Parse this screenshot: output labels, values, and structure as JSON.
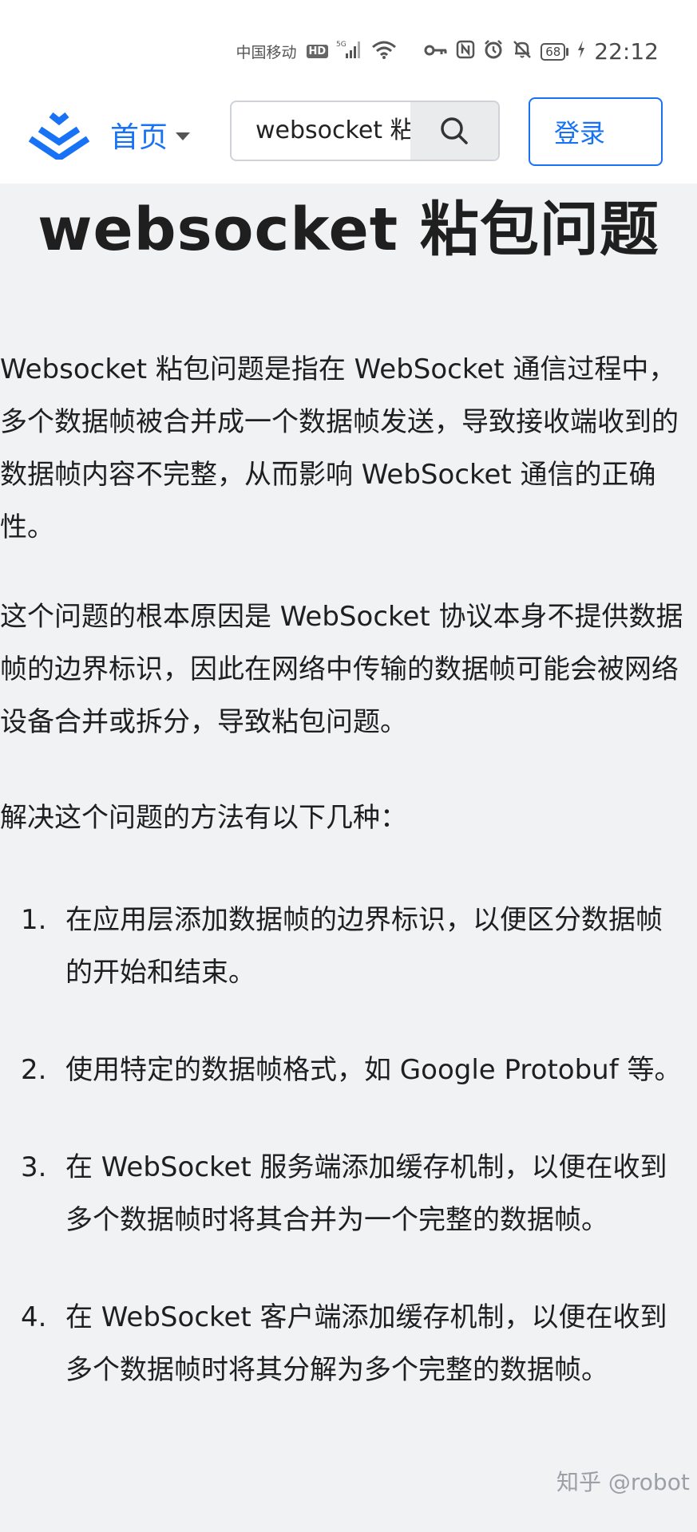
{
  "status_bar": {
    "carrier": "中国移动",
    "hd": "HD",
    "network": "5G",
    "battery": "68",
    "time": "22:12",
    "icons": [
      "signal-icon",
      "wifi-icon",
      "key-icon",
      "nfc-icon",
      "alarm-icon",
      "mute-icon",
      "battery-icon",
      "charging-icon"
    ]
  },
  "header": {
    "logo_icon": "zhihu-logo-icon",
    "home_label": "首页",
    "search_value": "websocket 粘",
    "login_label": "登录",
    "accent_color": "#1772f6"
  },
  "article": {
    "title": "websocket 粘包问题",
    "p1": "Websocket 粘包问题是指在 WebSocket 通信过程中，多个数据帧被合并成一个数据帧发送，导致接收端收到的数据帧内容不完整，从而影响 WebSocket 通信的正确性。",
    "p2": "这个问题的根本原因是 WebSocket 协议本身不提供数据帧的边界标识，因此在网络中传输的数据帧可能会被网络设备合并或拆分，导致粘包问题。",
    "p3": "解决这个问题的方法有以下几种：",
    "list": [
      {
        "num": "1.",
        "text": "在应用层添加数据帧的边界标识，以便区分数据帧的开始和结束。"
      },
      {
        "num": "2.",
        "text": "使用特定的数据帧格式，如 Google Protobuf 等。"
      },
      {
        "num": "3.",
        "text": "在 WebSocket 服务端添加缓存机制，以便在收到多个数据帧时将其合并为一个完整的数据帧。"
      },
      {
        "num": "4.",
        "text": "在 WebSocket 客户端添加缓存机制，以便在收到多个数据帧时将其分解为多个完整的数据帧。"
      }
    ]
  },
  "watermark": "知乎 @robot"
}
